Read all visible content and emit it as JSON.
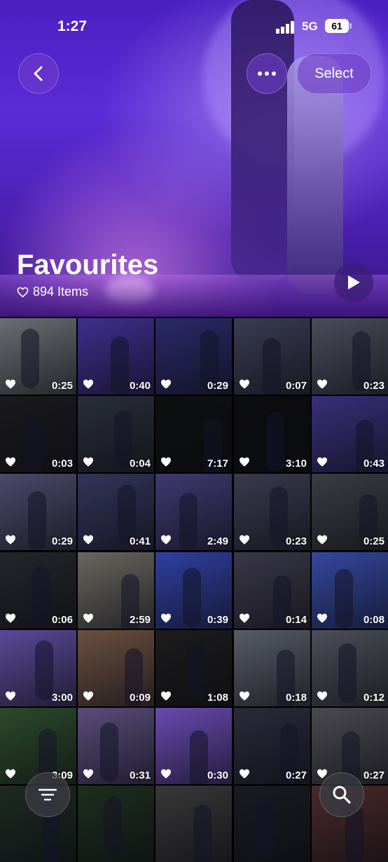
{
  "status_bar": {
    "time": "1:27",
    "network": "5G",
    "battery": "61"
  },
  "header": {
    "select_label": "Select",
    "title": "Favourites",
    "item_count": "894 Items"
  },
  "icons": {
    "back": "chevron-left-icon",
    "more": "ellipsis-icon",
    "play": "play-icon",
    "heart": "heart-outline-icon",
    "filter": "filter-lines-icon",
    "search": "search-icon"
  },
  "grid": {
    "durations": [
      "0:25",
      "0:40",
      "0:29",
      "0:07",
      "0:23",
      "0:03",
      "0:04",
      "7:17",
      "3:10",
      "0:43",
      "0:29",
      "0:41",
      "2:49",
      "0:23",
      "0:25",
      "0:06",
      "2:59",
      "0:39",
      "0:14",
      "0:08",
      "3:00",
      "0:09",
      "1:08",
      "0:18",
      "0:12",
      "3:09",
      "0:31",
      "0:30",
      "0:27",
      "0:27",
      "",
      "",
      "",
      "",
      ""
    ],
    "colors": [
      "#6b6e74",
      "#3f2f8e",
      "#2a2a6a",
      "#3a3c52",
      "#4a4c5a",
      "#1a1a1e",
      "#2a2e3a",
      "#0e1010",
      "#0c0d10",
      "#3a2f7a",
      "#4a4a6a",
      "#34345a",
      "#3e3a70",
      "#3a3a4e",
      "#3c3c44",
      "#24262c",
      "#6a6660",
      "#3040a0",
      "#3a3848",
      "#3548a0",
      "#5a4a98",
      "#6a5040",
      "#1c1c1c",
      "#585c66",
      "#4c4f58",
      "#2c4a2a",
      "#5a4c7a",
      "#6a4ab0",
      "#2a2a3a",
      "#4a4a50",
      "#1e2a22",
      "#1e2e1e",
      "#383838",
      "#1a1a22",
      "#4a2a2a"
    ]
  }
}
